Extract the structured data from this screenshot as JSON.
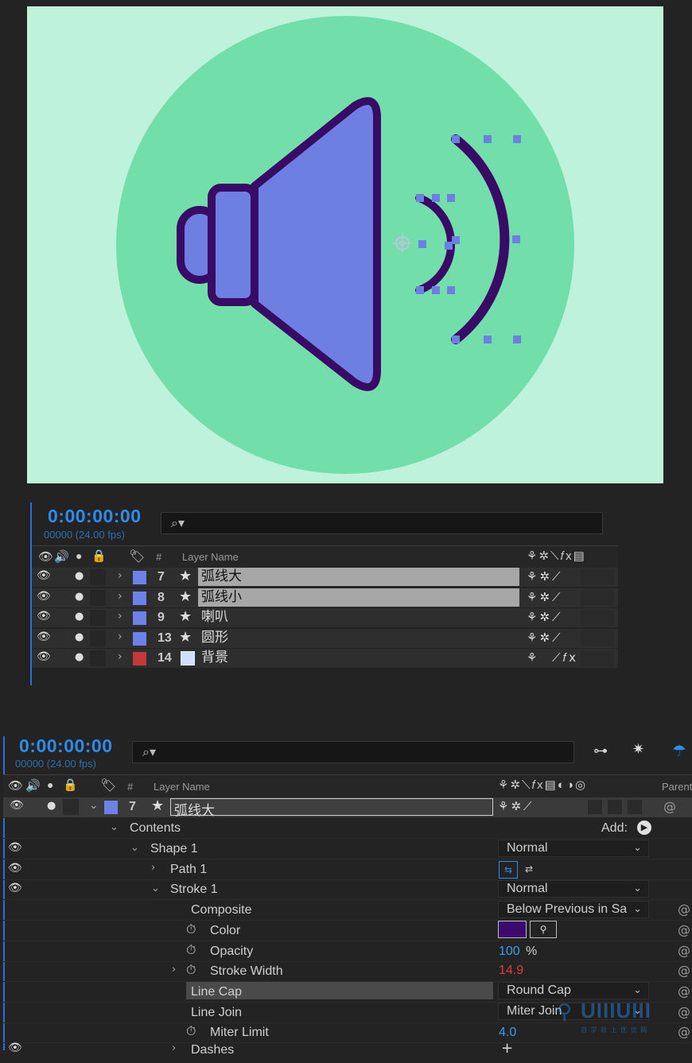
{
  "comp": {
    "colors": {
      "background": "#bff2da",
      "circle": "#72dea9",
      "speaker_fill": "#6d7fe0",
      "stroke": "#3a0b66",
      "handle": "#6d7fe0"
    }
  },
  "timeline1": {
    "timecode": "0:00:00:00",
    "fps": "00000 (24.00 fps)",
    "header": {
      "num": "#",
      "layer_name": "Layer Name"
    },
    "layers": [
      {
        "num": "7",
        "name": "弧线大",
        "label_color": "#6d82e8",
        "selected": true,
        "type": "star"
      },
      {
        "num": "8",
        "name": "弧线小",
        "label_color": "#6d82e8",
        "selected": true,
        "type": "star"
      },
      {
        "num": "9",
        "name": "喇叭",
        "label_color": "#6d82e8",
        "selected": false,
        "type": "star"
      },
      {
        "num": "13",
        "name": "圆形",
        "label_color": "#6d82e8",
        "selected": false,
        "type": "star"
      },
      {
        "num": "14",
        "name": "背景",
        "label_color": "#c23a3a",
        "selected": false,
        "type": "solid"
      }
    ]
  },
  "timeline2": {
    "timecode": "0:00:00:00",
    "fps": "00000 (24.00 fps)",
    "header": {
      "num": "#",
      "layer_name": "Layer Name",
      "parent": "Parent"
    },
    "layer": {
      "num": "7",
      "name": "弧线大"
    },
    "contents_label": "Contents",
    "add_label": "Add:",
    "shape1": {
      "label": "Shape 1",
      "blend": "Normal"
    },
    "path1": {
      "label": "Path 1"
    },
    "stroke1": {
      "label": "Stroke 1",
      "blend": "Normal"
    },
    "composite": {
      "label": "Composite",
      "value": "Below Previous in Sa"
    },
    "color": {
      "label": "Color",
      "swatch": "#3b0a6e"
    },
    "opacity": {
      "label": "Opacity",
      "value": "100",
      "unit": "%"
    },
    "stroke_width": {
      "label": "Stroke Width",
      "value": "14.9"
    },
    "line_cap": {
      "label": "Line Cap",
      "value": "Round Cap"
    },
    "line_join": {
      "label": "Line Join",
      "value": "Miter Join"
    },
    "miter_limit": {
      "label": "Miter Limit",
      "value": "4.0"
    },
    "dashes": {
      "label": "Dashes"
    }
  },
  "watermark": {
    "text": "UIIIUIII",
    "subtext": "自 学 就 上 优 优 网"
  }
}
